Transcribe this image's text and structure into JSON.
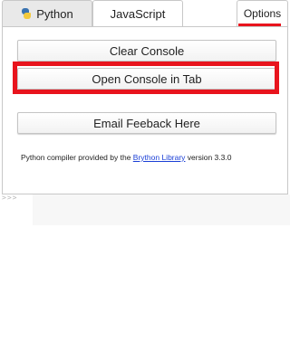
{
  "tabs": {
    "python_label": "Python",
    "javascript_label": "JavaScript",
    "options_label": "Options"
  },
  "panel": {
    "clear_console_label": "Clear Console",
    "open_console_label": "Open Console in Tab",
    "email_feedback_label": "Email Feeback Here",
    "credit_prefix": "Python compiler provided by the ",
    "credit_link": "Brython Library",
    "credit_suffix": " version 3.3.0"
  },
  "console": {
    "prompt": ">>>"
  },
  "colors": {
    "highlight": "#e8141d",
    "link": "#1a3fd6",
    "python_blue": "#3a73b0",
    "python_yellow": "#f3c93d"
  }
}
